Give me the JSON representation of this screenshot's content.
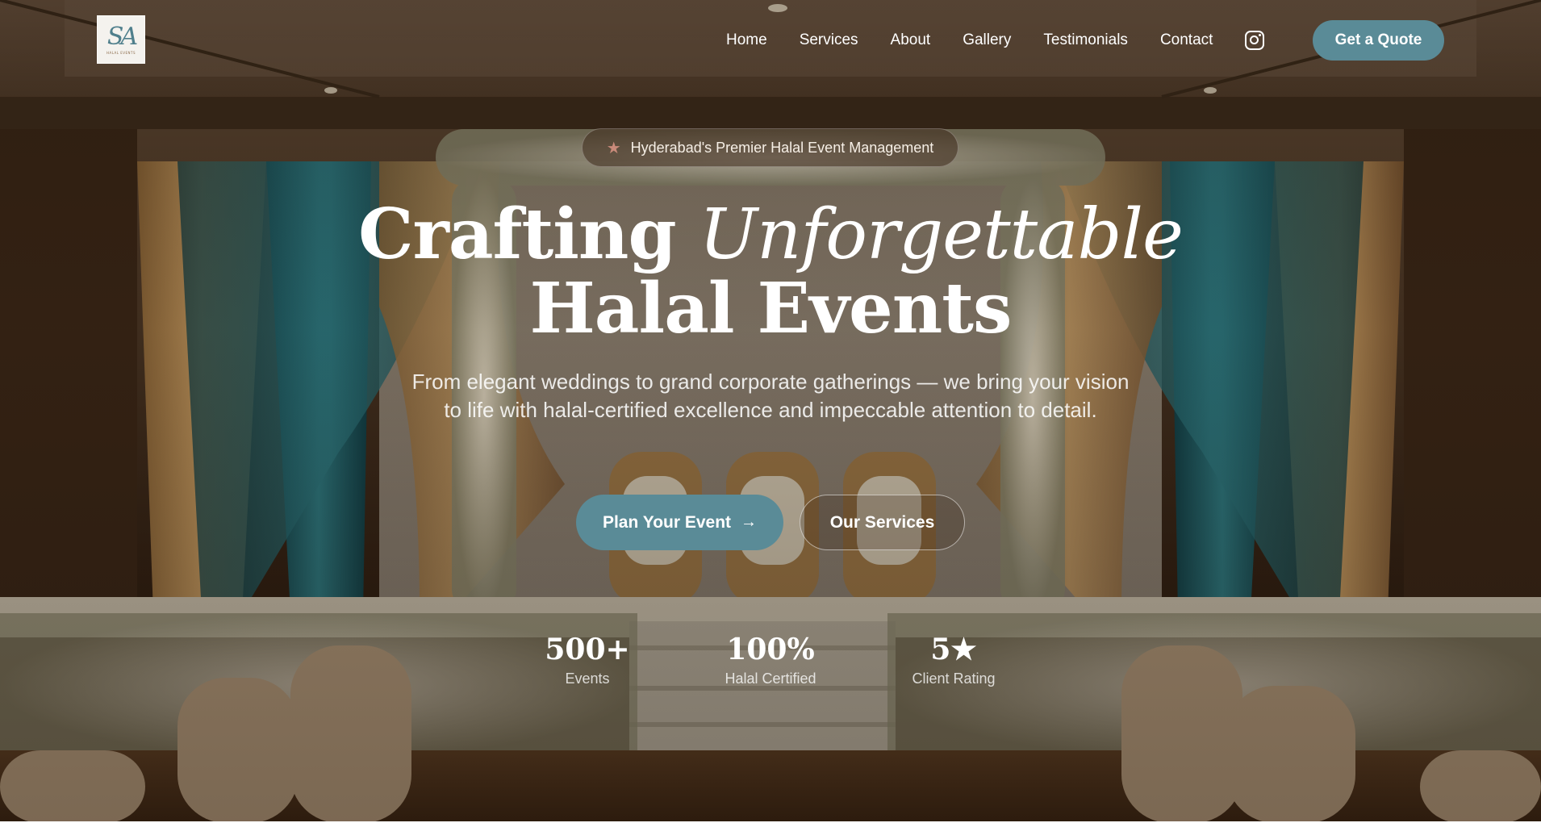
{
  "brand": {
    "logo_mark": "SA",
    "logo_subtext": "HALAL EVENTS"
  },
  "nav": {
    "links": [
      "Home",
      "Services",
      "About",
      "Gallery",
      "Testimonials",
      "Contact"
    ],
    "social_icon": "instagram-icon",
    "cta_label": "Get a Quote"
  },
  "hero": {
    "badge_icon": "star-icon",
    "badge_text": "Hyderabad's Premier Halal Event Management",
    "headline_line1_plain": "Crafting ",
    "headline_line1_accent": "Unforgettable",
    "headline_line2": "Halal Events",
    "subtext": "From elegant weddings to grand corporate gatherings — we bring your vision to life with halal-certified excellence and impeccable attention to detail.",
    "primary_cta": "Plan Your Event",
    "primary_cta_icon": "arrow-right-icon",
    "secondary_cta": "Our Services"
  },
  "stats": [
    {
      "value": "500+",
      "label": "Events"
    },
    {
      "value": "100%",
      "label": "Halal Certified"
    },
    {
      "value": "5★",
      "label": "Client Rating"
    }
  ],
  "colors": {
    "accent_teal": "#5a8b97",
    "logo_teal": "#4f7f8c",
    "badge_star": "#c98a7a"
  }
}
